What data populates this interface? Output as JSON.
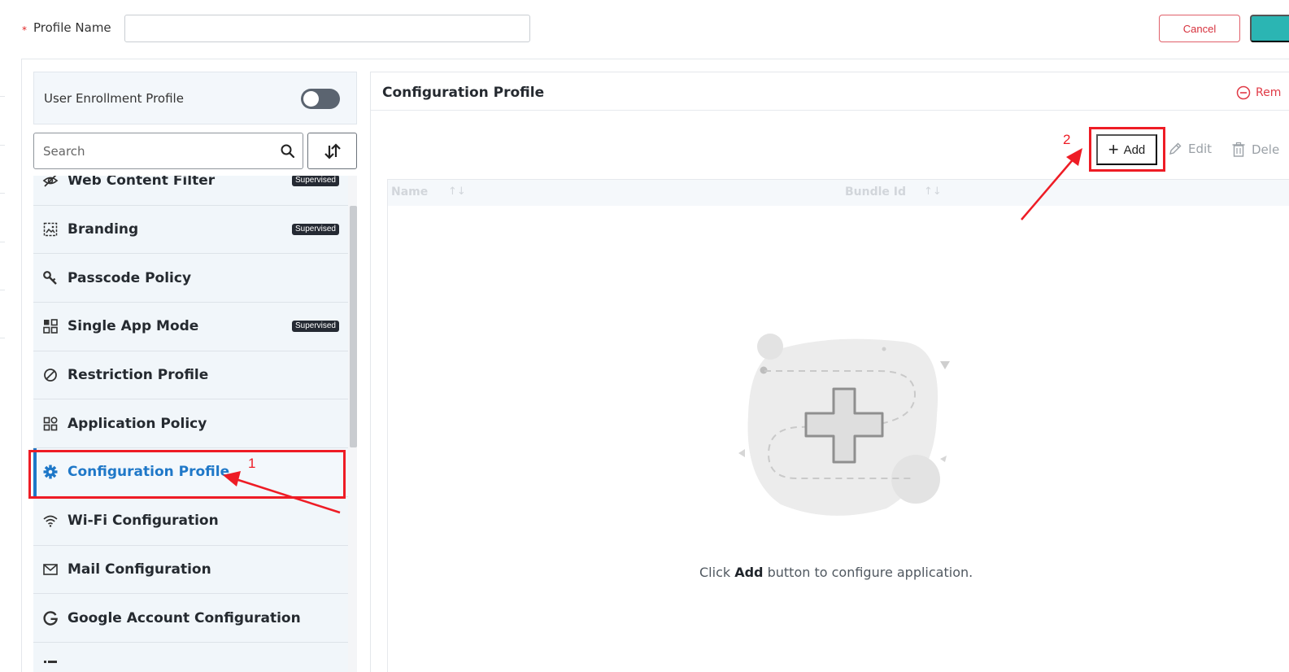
{
  "header": {
    "required_marker": "*",
    "profile_name_label": "Profile Name",
    "profile_name_value": "",
    "cancel_label": "Cancel"
  },
  "left_panel": {
    "enrollment_label": "User Enrollment Profile",
    "enrollment_enabled": false,
    "search_placeholder": "Search",
    "items": [
      {
        "label": "Web Content Filter",
        "icon": "eye-off-icon",
        "badge": "Supervised"
      },
      {
        "label": "Branding",
        "icon": "image-icon",
        "badge": "Supervised"
      },
      {
        "label": "Passcode Policy",
        "icon": "key-icon",
        "badge": ""
      },
      {
        "label": "Single App Mode",
        "icon": "grid-icon",
        "badge": "Supervised"
      },
      {
        "label": "Restriction Profile",
        "icon": "ban-icon",
        "badge": ""
      },
      {
        "label": "Application Policy",
        "icon": "apps-icon",
        "badge": ""
      },
      {
        "label": "Configuration Profile",
        "icon": "gear-icon",
        "badge": "",
        "active": true
      },
      {
        "label": "Wi-Fi Configuration",
        "icon": "wifi-icon",
        "badge": ""
      },
      {
        "label": "Mail Configuration",
        "icon": "mail-icon",
        "badge": ""
      },
      {
        "label": "Google Account Configuration",
        "icon": "google-icon",
        "badge": ""
      }
    ]
  },
  "right_panel": {
    "title": "Configuration Profile",
    "remove_label": "Rem",
    "add_label": "Add",
    "edit_label": "Edit",
    "delete_label": "Dele",
    "columns": [
      "Name",
      "Bundle Id"
    ],
    "empty_prefix": "Click ",
    "empty_bold": "Add",
    "empty_suffix": " button to configure application."
  },
  "annotations": {
    "step1": "1",
    "step2": "2",
    "color": "#ee1c25"
  },
  "colors": {
    "accent": "#1f78c8",
    "danger": "#d6303c",
    "primary_button": "#2bb5b3",
    "badge_bg": "#252a33"
  }
}
